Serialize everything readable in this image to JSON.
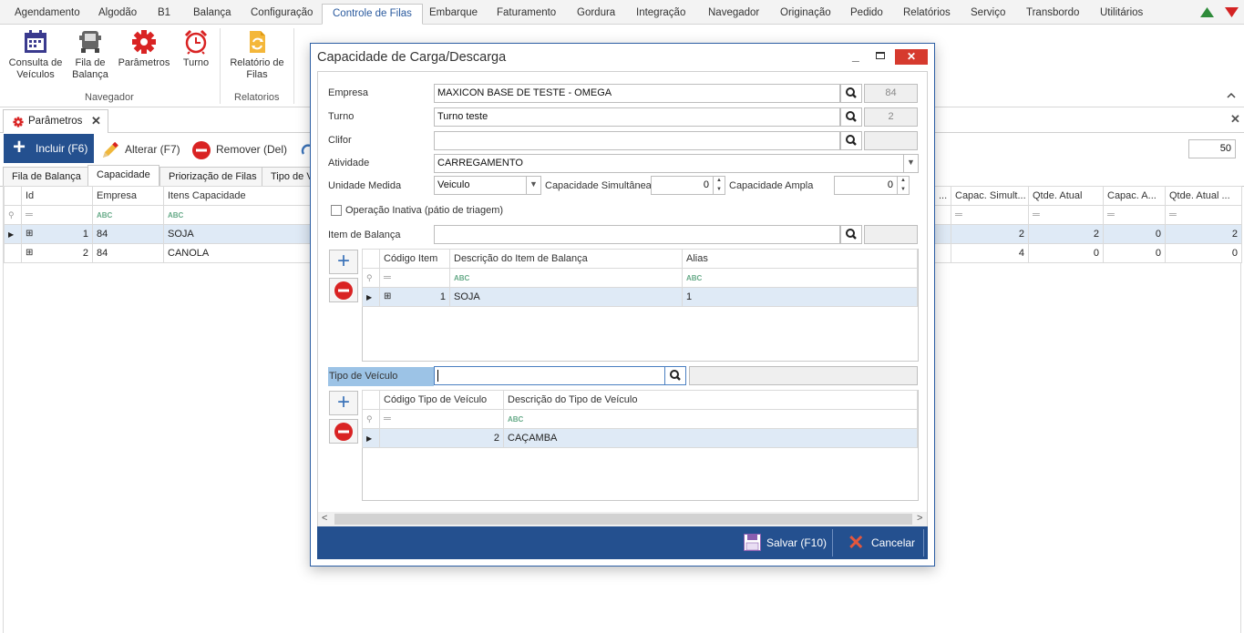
{
  "menubar": {
    "items": [
      "Agendamento",
      "Algodão",
      "B1",
      "Balança",
      "Configuração",
      "Controle de Filas",
      "Embarque",
      "Faturamento",
      "Gordura",
      "Integração",
      "Navegador",
      "Originação",
      "Pedido",
      "Relatórios",
      "Serviço",
      "Transbordo",
      "Utilitários"
    ],
    "active_index": 5
  },
  "ribbon": {
    "buttons": [
      {
        "label": "Consulta de Veículos",
        "icon": "calendar-icon"
      },
      {
        "label": "Fila de Balança",
        "icon": "truck-icon"
      },
      {
        "label": "Parâmetros",
        "icon": "gear-icon"
      },
      {
        "label": "Turno",
        "icon": "alarm-clock-icon"
      },
      {
        "label": "Relatório de Filas",
        "icon": "report-refresh-icon"
      }
    ],
    "groups": [
      "Navegador",
      "Relatorios"
    ]
  },
  "doc_tab": {
    "label": "Parâmetros"
  },
  "toolbar": {
    "incluir": "Incluir (F6)",
    "alterar": "Alterar (F7)",
    "remover": "Remover (Del)",
    "page_size": "50"
  },
  "subtabs": [
    "Fila de Balança",
    "Capacidade",
    "Priorização de Filas",
    "Tipo de V"
  ],
  "main_grid": {
    "left_columns": [
      "Id",
      "Empresa",
      "Itens Capacidade"
    ],
    "right_columns": [
      "Capac. Simult...",
      "Qtde. Atual",
      "Capac. A...",
      "Qtde. Atual ..."
    ],
    "right_partial": "...",
    "rows": [
      {
        "id": "1",
        "empresa": "84",
        "itens": "SOJA",
        "capac_simult": "2",
        "qtde_atual": "2",
        "capac_ampla": "0",
        "qtde_atual2": "2"
      },
      {
        "id": "2",
        "empresa": "84",
        "itens": "CANOLA",
        "capac_simult": "4",
        "qtde_atual": "0",
        "capac_ampla": "0",
        "qtde_atual2": "0"
      }
    ]
  },
  "dialog": {
    "title": "Capacidade de Carga/Descarga",
    "empresa": {
      "label": "Empresa",
      "value": "MAXICON BASE DE TESTE - OMEGA",
      "code": "84"
    },
    "turno": {
      "label": "Turno",
      "value": "Turno teste",
      "code": "2"
    },
    "clifor": {
      "label": "Clifor",
      "value": "",
      "code": ""
    },
    "atividade": {
      "label": "Atividade",
      "value": "CARREGAMENTO"
    },
    "unidade_medida": {
      "label": "Unidade Medida",
      "value": "Veiculo"
    },
    "capacidade_simultanea": {
      "label": "Capacidade Simultânea",
      "value": "0"
    },
    "capacidade_ampla": {
      "label": "Capacidade Ampla",
      "value": "0"
    },
    "operacao_inativa": {
      "label": "Operação Inativa (pátio de triagem)",
      "checked": false
    },
    "item_balanca": {
      "label": "Item de Balança",
      "value": ""
    },
    "items_grid": {
      "columns": [
        "Código Item",
        "Descrição do Item de Balança",
        "Alias"
      ],
      "rows": [
        {
          "codigo": "1",
          "descricao": "SOJA",
          "alias": "1"
        }
      ]
    },
    "tipo_veiculo": {
      "label": "Tipo de Veículo",
      "value": ""
    },
    "veiculo_grid": {
      "columns": [
        "Código Tipo de Veículo",
        "Descrição do Tipo de Veículo"
      ],
      "rows": [
        {
          "codigo": "2",
          "descricao": "CAÇAMBA"
        }
      ]
    },
    "save_label": "Salvar (F10)",
    "cancel_label": "Cancelar"
  },
  "colors": {
    "accent": "#24508f",
    "selected_row": "#dfeaf6",
    "highlight_label": "#9cc3e6",
    "remove_red": "#d92323",
    "add_blue": "#3b73b9"
  }
}
